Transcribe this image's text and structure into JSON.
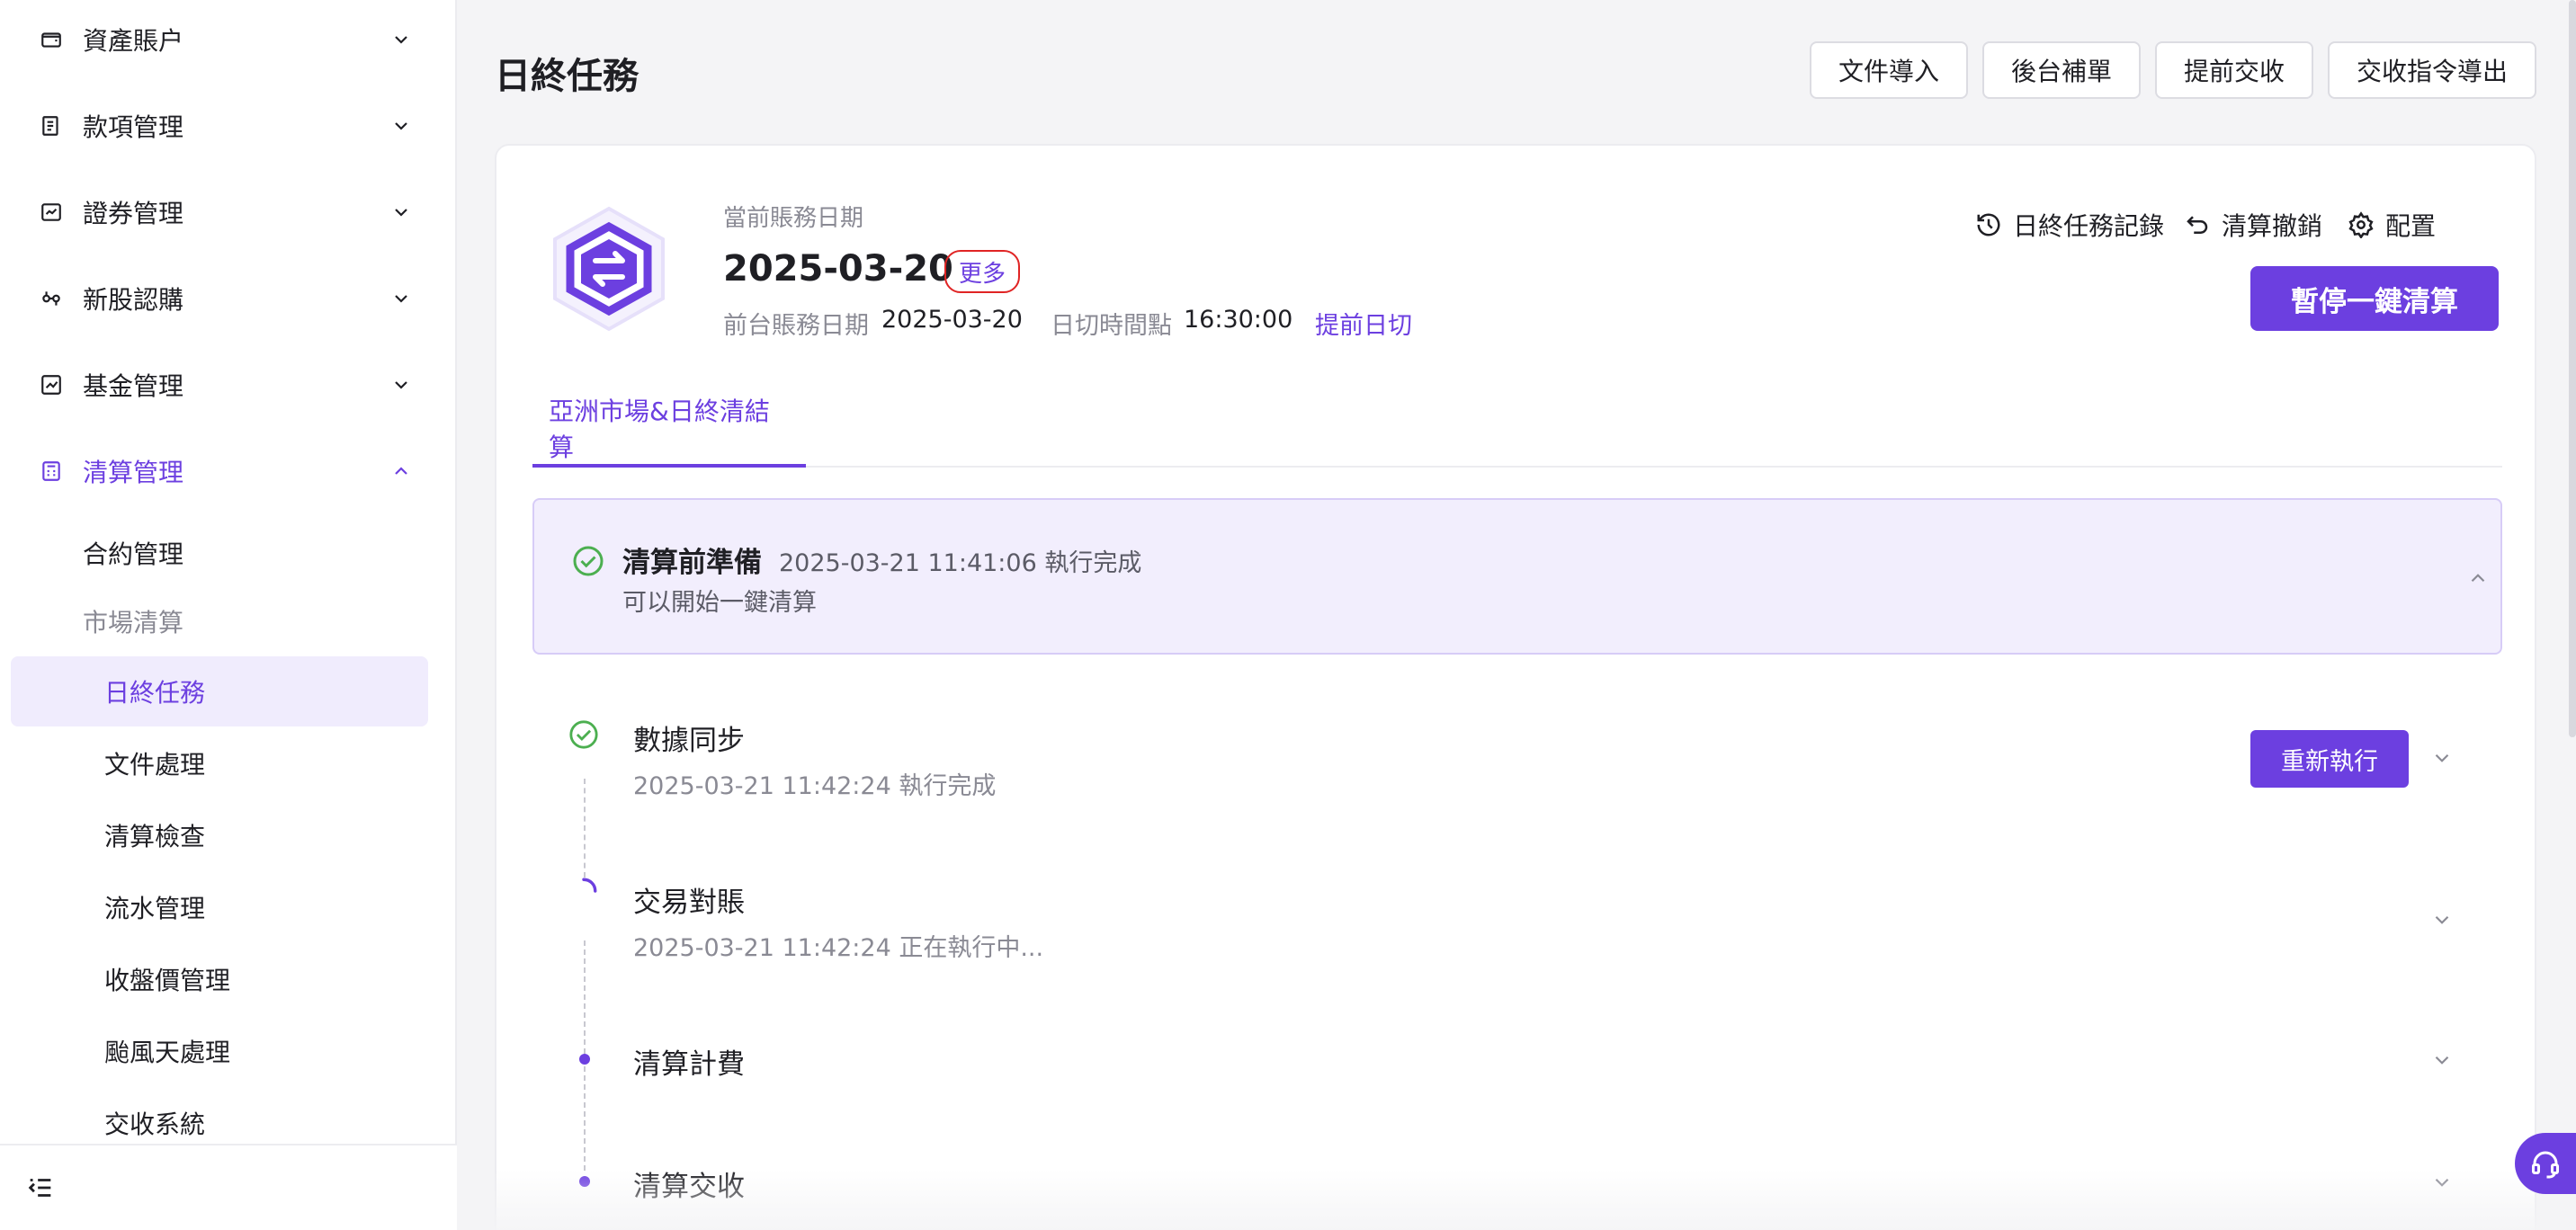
{
  "sidebar": {
    "groups": [
      {
        "label": "資產賬户",
        "icon": "wallet-icon"
      },
      {
        "label": "款項管理",
        "icon": "receipt-icon"
      },
      {
        "label": "證券管理",
        "icon": "securities-icon"
      },
      {
        "label": "新股認購",
        "icon": "ipo-icon"
      },
      {
        "label": "基金管理",
        "icon": "fund-chart-icon"
      },
      {
        "label": "清算管理",
        "icon": "calculator-icon"
      }
    ],
    "sub_items": [
      {
        "label": "合約管理"
      },
      {
        "label": "市場清算"
      },
      {
        "label": "日終任務"
      },
      {
        "label": "文件處理"
      },
      {
        "label": "清算檢查"
      },
      {
        "label": "流水管理"
      },
      {
        "label": "收盤價管理"
      },
      {
        "label": "颱風天處理"
      },
      {
        "label": "交收系統"
      }
    ]
  },
  "header": {
    "title": "日終任務",
    "buttons": [
      "文件導入",
      "後台補單",
      "提前交收",
      "交收指令導出"
    ]
  },
  "card": {
    "date_label": "當前賬務日期",
    "date_value": "2025-03-20",
    "more_label": "更多",
    "front_label": "前台賬務日期",
    "front_value": "2025-03-20",
    "cutoff_label": "日切時間點",
    "cutoff_value": "16:30:00",
    "early_cut_label": "提前日切",
    "actions": [
      "日終任務記錄",
      "清算撤銷",
      "配置"
    ],
    "primary_label": "暫停一鍵清算",
    "tab_label": "亞洲市場&日終清結算"
  },
  "prep": {
    "title": "清算前準備",
    "time": "2025-03-21 11:41:06 執行完成",
    "desc": "可以開始一鍵清算"
  },
  "steps": [
    {
      "title": "數據同步",
      "time": "2025-03-21 11:42:24 執行完成",
      "status": "done"
    },
    {
      "title": "交易對賬",
      "time": "2025-03-21 11:42:24 正在執行中...",
      "status": "running"
    },
    {
      "title": "清算計費",
      "time": "",
      "status": "pending"
    },
    {
      "title": "清算交收",
      "time": "",
      "status": "pending"
    }
  ],
  "rerun_label": "重新執行",
  "colors": {
    "accent": "#6c3fe0",
    "success": "#4caf50",
    "badge_border": "#e02424"
  }
}
